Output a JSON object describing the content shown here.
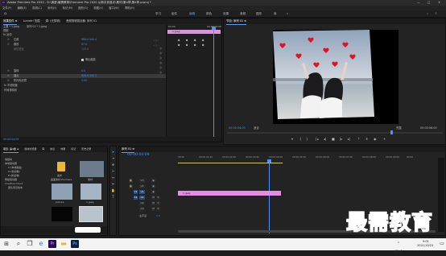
{
  "app": {
    "title": "Adobe Premiere Pro 2020 - D:\\调音\\最需教育\\Premiere Pro 2020 从新手到高手\\素材\\第4章\\第4章.prproj *",
    "window_controls": [
      "—",
      "□",
      "✕"
    ]
  },
  "menu": [
    "文件(F)",
    "编辑(E)",
    "剪辑(C)",
    "序列(S)",
    "标记(M)",
    "图形(G)",
    "视图(V)",
    "窗口(W)",
    "帮助(H)"
  ],
  "workspaces": [
    "学习",
    "组件",
    "编辑",
    "颜色",
    "效果",
    "音频",
    "图形",
    "库"
  ],
  "active_workspace": "编辑",
  "effect_controls": {
    "tabs": [
      "效果控件 ≡",
      "Lumetri 范围",
      "源: (无剪辑)",
      "音频剪辑混合器: 序列 01"
    ],
    "source": "主要 * 1.jpeg",
    "sequence": "序列 01 * 1.jpeg",
    "section_video": "视频",
    "motion_label": "fx 运动",
    "rows": [
      {
        "name": "位置",
        "value": "960.0   540.0"
      },
      {
        "name": "缩放",
        "value": "87.0"
      },
      {
        "name": "缩放宽度",
        "value": "100.0"
      },
      {
        "name": "",
        "value": ""
      },
      {
        "name": "旋转",
        "value": "0.0"
      },
      {
        "name": "锚点",
        "value": "958.0   540.0"
      },
      {
        "name": "防闪烁滤镜",
        "value": "0.00"
      },
      {
        "name": "fx 不透明度",
        "value": ""
      },
      {
        "name": "时间重映射",
        "value": ""
      }
    ],
    "uniform_scale": "等比缩放",
    "mini_timeline_start": "00:00",
    "mini_timeline_end": "00:00:04:00",
    "clip_label": "1.jpeg",
    "timecode": "00:00:04:09"
  },
  "program": {
    "title": "节目: 序列 01 ≡",
    "timecode": "00:00:04:09",
    "fit": "适合",
    "quality": "完整",
    "duration": "00:00:06:00"
  },
  "project": {
    "tabs": [
      "项目: 第4章 ≡",
      "媒体浏览器",
      "库",
      "信息",
      "效果",
      "标记",
      "历史记录"
    ],
    "tree": [
      "收藏夹",
      "本地驱动器",
      "C:(本地磁盘)",
      "D:(新加卷)",
      "E:(新加卷)",
      "网络驱动器",
      "Creative Cloud",
      "团队项目版本"
    ],
    "thumbs": [
      "发布",
      "画面素材 Premiere",
      "素材",
      "",
      "picture",
      "1.jpeg",
      "",
      ""
    ]
  },
  "timeline": {
    "title": "序列 01 ≡",
    "timecode": "00:00:04:09",
    "ruler": [
      "00:00",
      "00:00:01:00",
      "00:00:02:00",
      "00:00:03:00",
      "00:00:04:00",
      "00:00:05:00",
      "00:00:06:00",
      "00:00:07:00",
      "00:00:08:00",
      "00:00:09:00",
      "00:00"
    ],
    "tracks": [
      "V3",
      "V2",
      "V1",
      "A1",
      "A2",
      "A3",
      "主声道"
    ],
    "master_value": "0.0",
    "clip_label": "1.jpeg"
  },
  "watermark": "最需教育",
  "taskbar": {
    "time": "9:01",
    "date": "2021/10/22"
  },
  "colors": {
    "accent": "#5b9bff",
    "clip": "#e58ce6",
    "playhead": "#4a90ff"
  }
}
